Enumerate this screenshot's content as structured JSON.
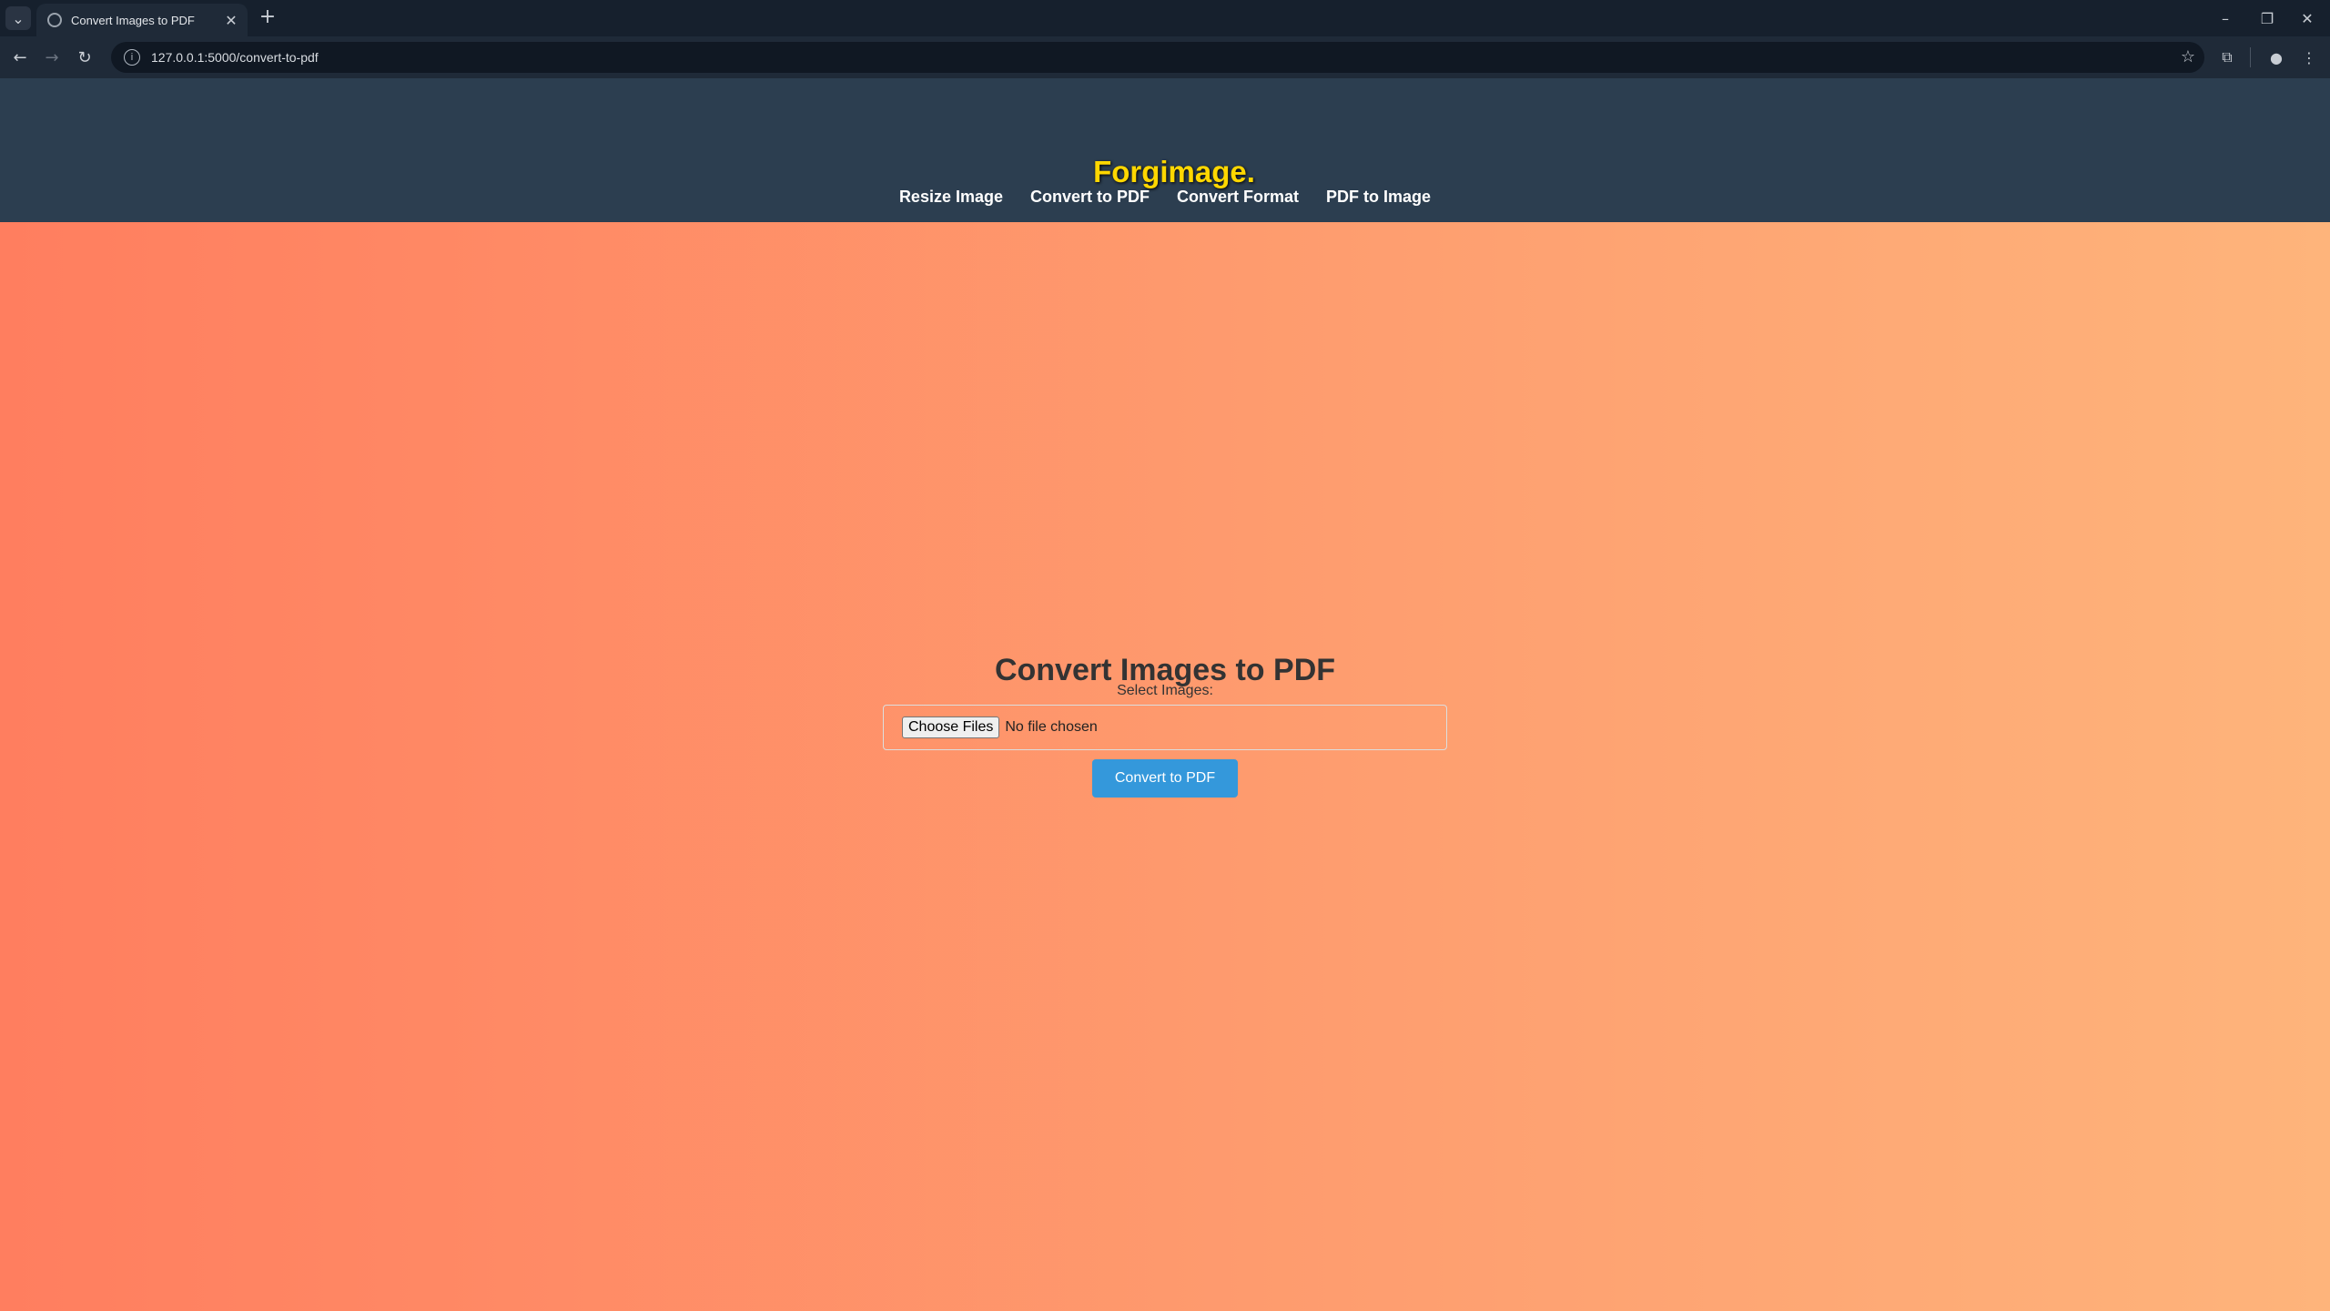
{
  "browser": {
    "tab_title": "Convert Images to PDF",
    "url": "127.0.0.1:5000/convert-to-pdf",
    "icons": {
      "tab_search": "chevron-down-icon",
      "close_tab": "close-icon",
      "new_tab": "plus-icon",
      "minimize": "minimize-icon",
      "restore": "restore-icon",
      "close_window": "close-icon",
      "back": "back-arrow-icon",
      "forward": "forward-arrow-icon",
      "reload": "reload-icon",
      "site_info": "info-icon",
      "bookmark": "star-icon",
      "extensions": "puzzle-icon",
      "profile": "profile-icon",
      "menu": "kebab-menu-icon"
    },
    "glyphs": {
      "tab_search": "⌄",
      "close_tab": "✕",
      "new_tab": "+",
      "minimize": "–",
      "restore": "❐",
      "close_window": "✕",
      "back": "←",
      "forward": "→",
      "reload": "↻",
      "site_info": "i",
      "bookmark": "☆",
      "extensions": "⧉",
      "profile": "●",
      "menu": "⋮"
    }
  },
  "site": {
    "logo": "Forgimage.",
    "nav": [
      {
        "label": "Resize Image"
      },
      {
        "label": "Convert to PDF"
      },
      {
        "label": "Convert Format"
      },
      {
        "label": "PDF to Image"
      }
    ]
  },
  "form": {
    "heading": "Convert Images to PDF",
    "label": "Select Images:",
    "choose_button": "Choose Files",
    "file_status": "No file chosen",
    "submit": "Convert to PDF"
  },
  "colors": {
    "header_bg": "#2c3e50",
    "logo": "#ffd700",
    "gradient_start": "#ff7e5f",
    "gradient_end": "#feb47b",
    "button": "#3498db"
  }
}
